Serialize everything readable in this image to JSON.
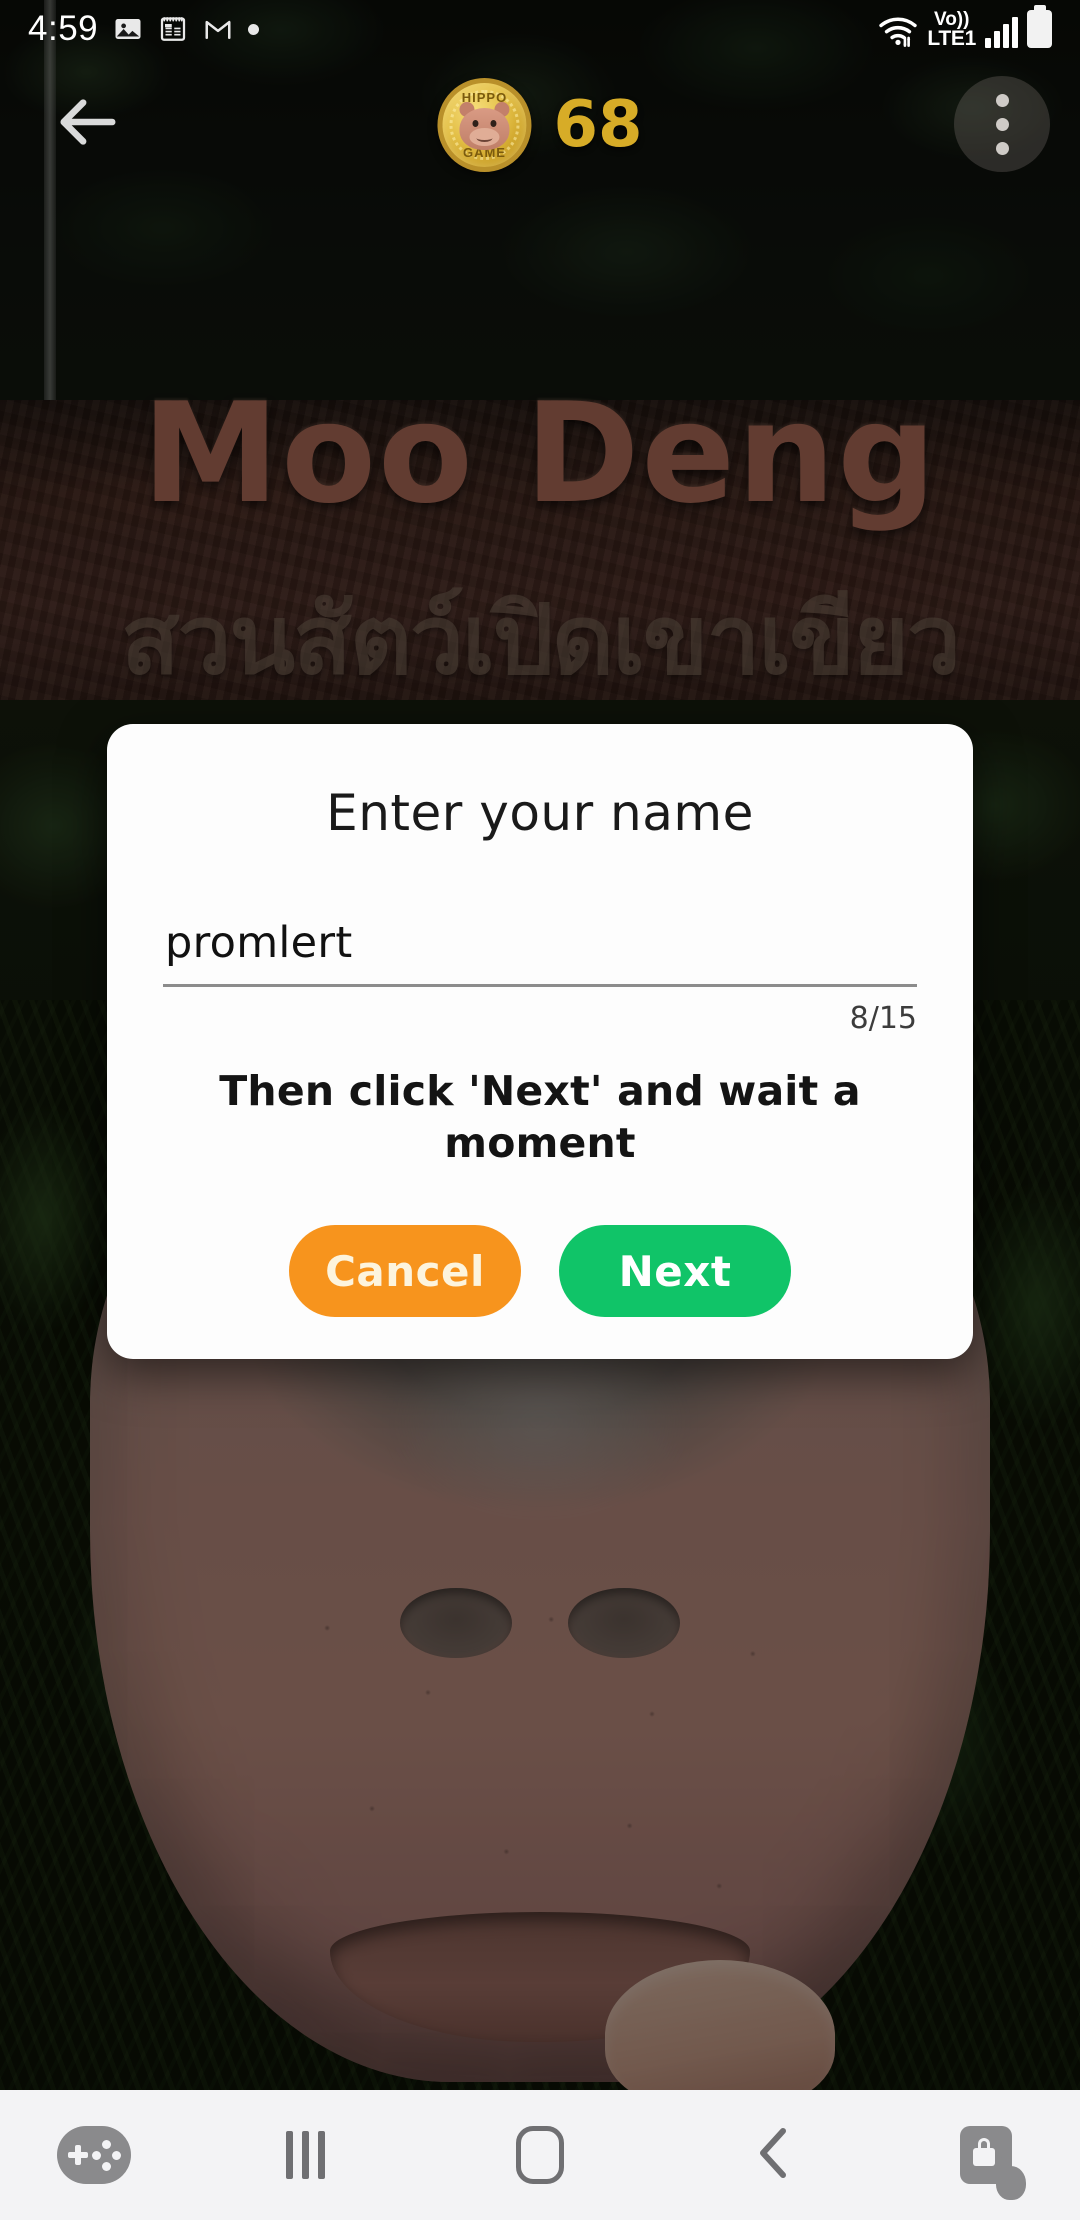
{
  "status_bar": {
    "time": "4:59",
    "left_icons": [
      "gallery-icon",
      "notes-icon",
      "gmail-icon",
      "dot-indicator"
    ],
    "right_icons": [
      "wifi-icon",
      "volte-icon",
      "signal-icon",
      "battery-icon"
    ],
    "volte_top": "Vo))",
    "volte_bottom": "LTE1"
  },
  "game_header": {
    "back_icon": "arrow-left-icon",
    "coin": {
      "icon": "hippo-coin-icon",
      "top_text": "HIPPO",
      "bottom_text": "GAME",
      "count": "68"
    },
    "menu_icon": "more-vertical-icon"
  },
  "background": {
    "sign_title": "Moo Deng",
    "sign_thai": "สวนสัตว์เปิดเขาเขียว",
    "photo_subject": "baby-pygmy-hippo-photo"
  },
  "dialog": {
    "title": "Enter your name",
    "input_value": "promlert",
    "input_placeholder": "",
    "counter": "8/15",
    "instruction": "Then click 'Next' and wait a moment",
    "cancel_label": "Cancel",
    "next_label": "Next"
  },
  "nav_bar": {
    "game_tools_icon": "game-booster-icon",
    "recents_icon": "recents-icon",
    "home_icon": "home-icon",
    "back_icon": "back-chevron-icon",
    "lock_icon": "touch-lock-icon"
  },
  "colors": {
    "cancel_orange": "#f7941d",
    "next_green": "#10c468",
    "coin_gold": "#d7ac27",
    "sign_brown": "#b5705b",
    "dialog_bg": "#fdfdfd",
    "nav_bg": "#f3f3f5"
  }
}
